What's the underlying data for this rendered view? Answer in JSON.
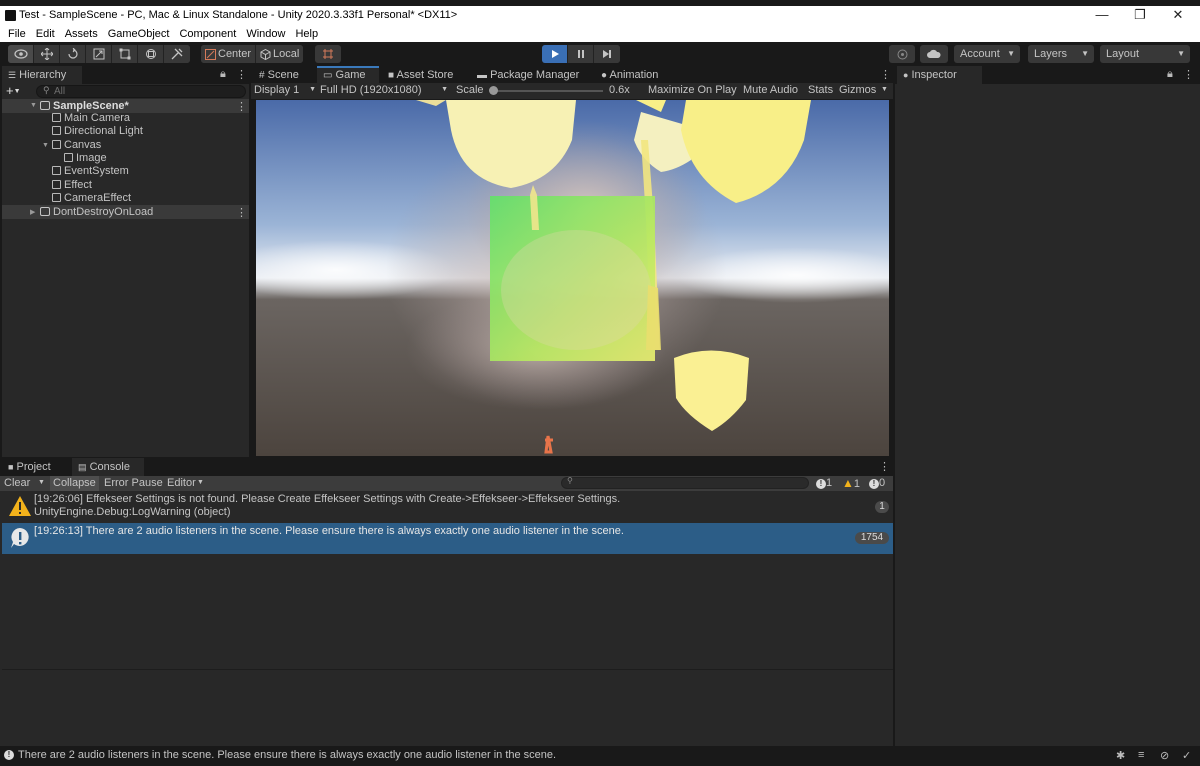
{
  "window": {
    "title": "Test - SampleScene - PC, Mac & Linux Standalone - Unity 2020.3.33f1 Personal* <DX11>",
    "minimize": "—",
    "restore": "❐",
    "close": "✕"
  },
  "menu": [
    "File",
    "Edit",
    "Assets",
    "GameObject",
    "Component",
    "Window",
    "Help"
  ],
  "toolbar": {
    "pivot_label": "Center",
    "space_label": "Local",
    "account_label": "Account",
    "layers_label": "Layers",
    "layout_label": "Layout",
    "accent_play": "#3a6fb5"
  },
  "hierarchy": {
    "tab_label": "Hierarchy",
    "search_placeholder": "All",
    "add_label": "+",
    "items": [
      {
        "label": "SampleScene*"
      },
      {
        "label": "Main Camera"
      },
      {
        "label": "Directional Light"
      },
      {
        "label": "Canvas"
      },
      {
        "label": "Image"
      },
      {
        "label": "EventSystem"
      },
      {
        "label": "Effect"
      },
      {
        "label": "CameraEffect"
      },
      {
        "label": "DontDestroyOnLoad"
      }
    ]
  },
  "center_tabs": {
    "scene": "Scene",
    "game": "Game",
    "asset_store": "Asset Store",
    "package_manager": "Package Manager",
    "animation": "Animation"
  },
  "game_bar": {
    "display": "Display 1",
    "resolution": "Full HD (1920x1080)",
    "scale_label": "Scale",
    "scale_value": "0.6x",
    "maximize": "Maximize On Play",
    "mute": "Mute Audio",
    "stats": "Stats",
    "gizmos": "Gizmos"
  },
  "inspector": {
    "tab_label": "Inspector"
  },
  "bottom_tabs": {
    "project": "Project",
    "console": "Console"
  },
  "console": {
    "clear": "Clear",
    "collapse": "Collapse",
    "error_pause": "Error Pause",
    "editor": "Editor",
    "count_errors": "1",
    "count_warnings": "1",
    "count_logs": "0",
    "entries": [
      {
        "line1": "[19:26:06] Effekseer Settings is not found. Please Create Effekseer Settings with Create->Effekseer->Effekseer Settings.",
        "line2": "UnityEngine.Debug:LogWarning (object)",
        "count": "1"
      },
      {
        "line1": "[19:26:13] There are 2 audio listeners in the scene. Please ensure there is always exactly one audio listener in the scene.",
        "line2": "",
        "count": "1754"
      }
    ]
  },
  "status_bar": {
    "message": "There are 2 audio listeners in the scene. Please ensure there is always exactly one audio listener in the scene."
  }
}
